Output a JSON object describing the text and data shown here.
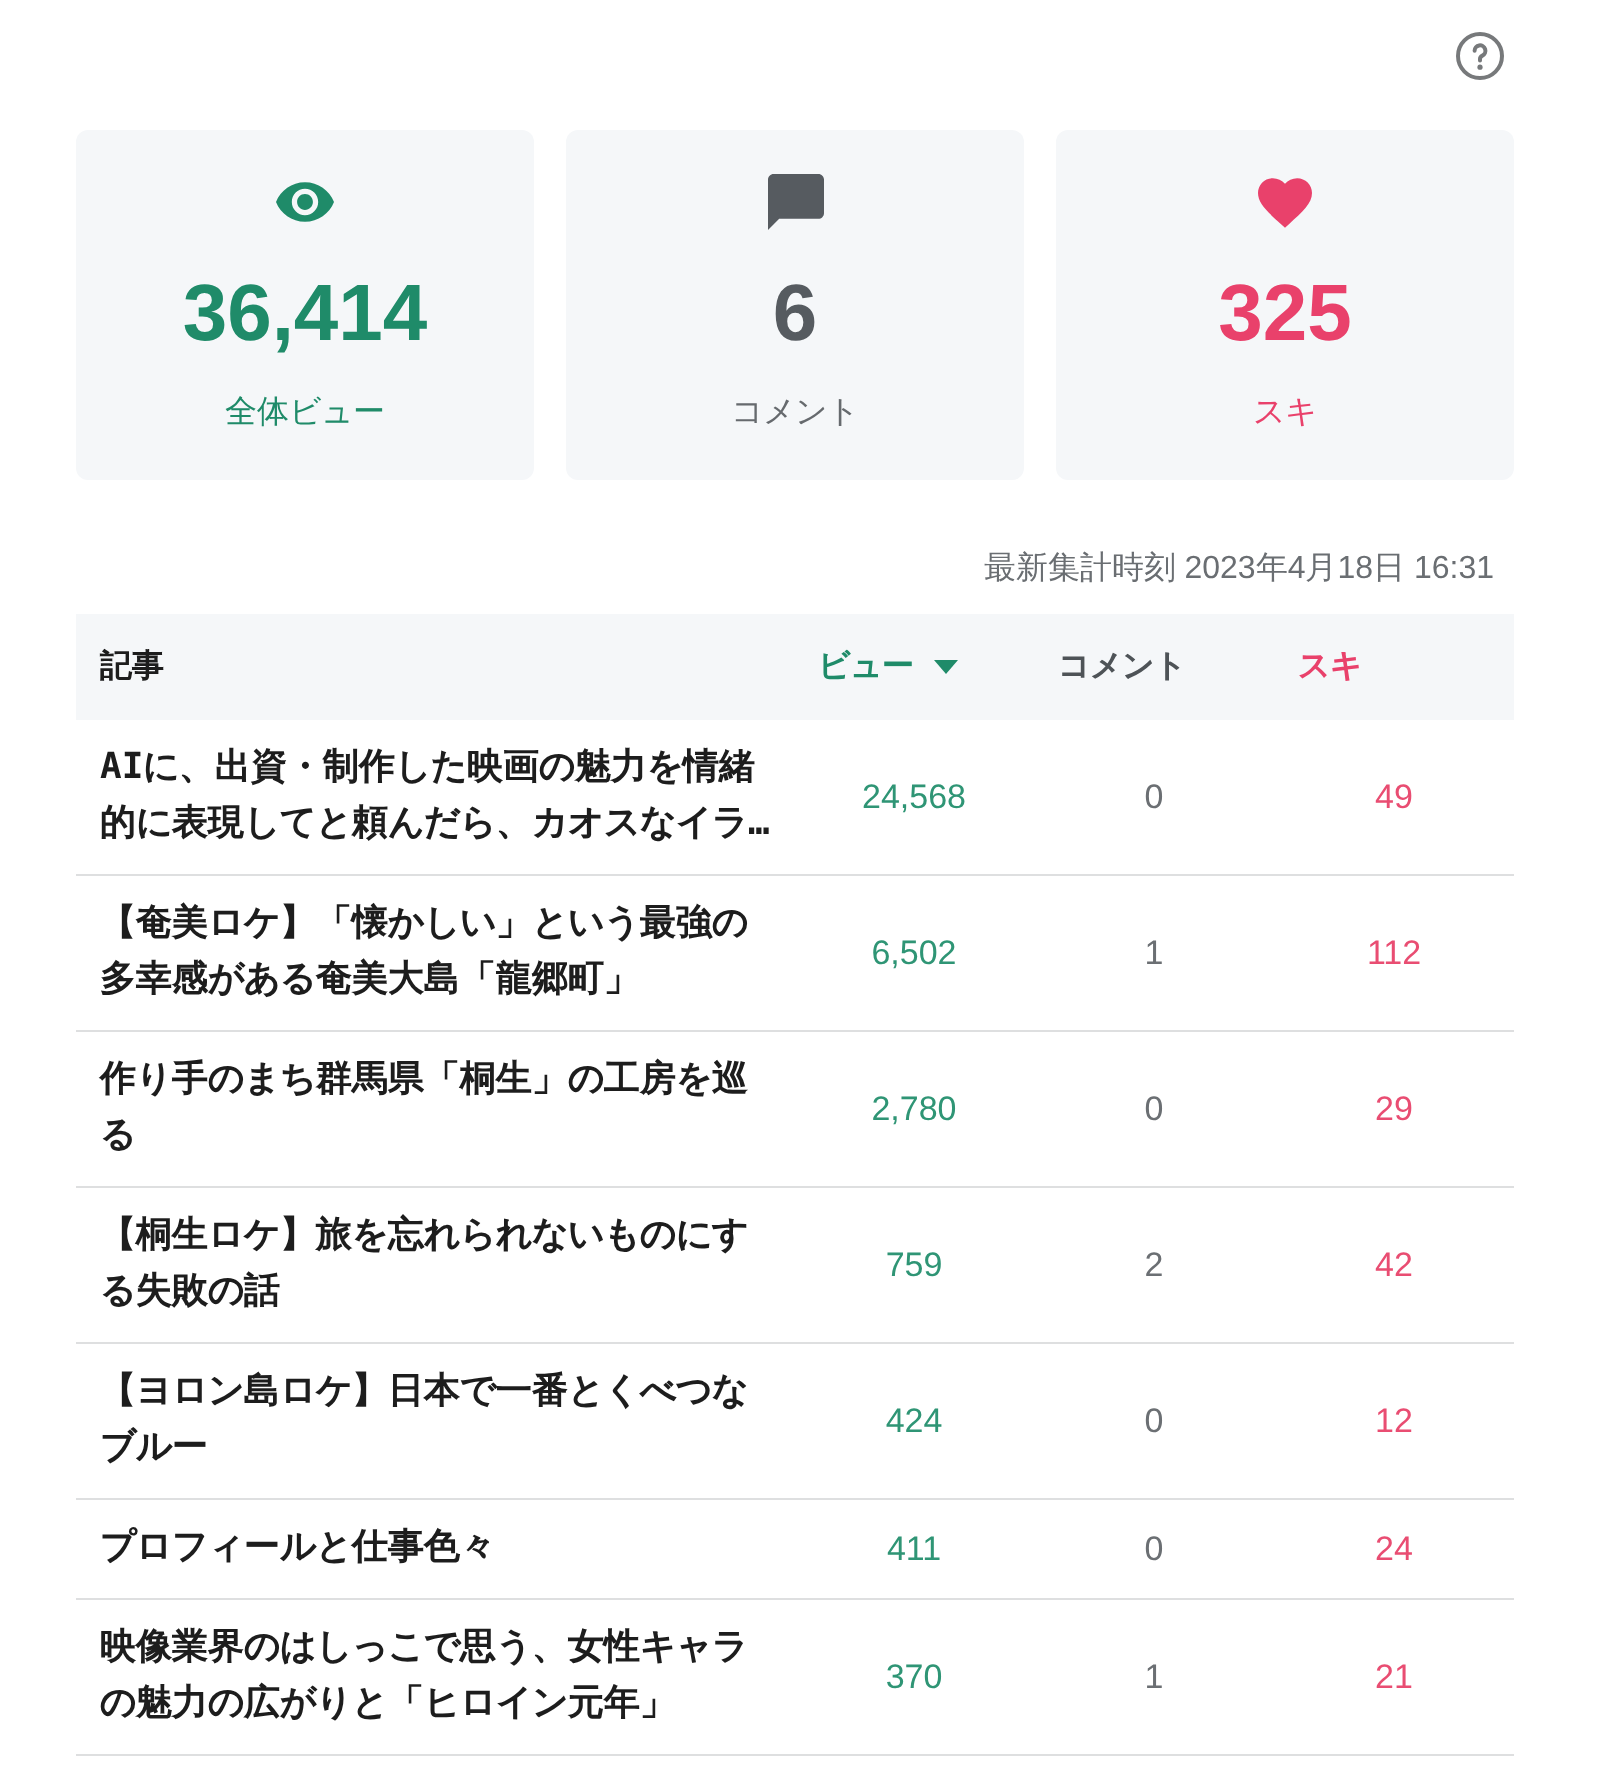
{
  "summary": [
    {
      "kind": "views",
      "value": "36,414",
      "label": "全体ビュー"
    },
    {
      "kind": "comments",
      "value": "6",
      "label": "コメント"
    },
    {
      "kind": "likes",
      "value": "325",
      "label": "スキ"
    }
  ],
  "updated": "最新集計時刻 2023年4月18日 16:31",
  "table": {
    "columns": [
      {
        "kind": "title",
        "label": "記事",
        "sorted": false
      },
      {
        "kind": "views",
        "label": "ビュー",
        "sorted": true
      },
      {
        "kind": "comments",
        "label": "コメント",
        "sorted": false
      },
      {
        "kind": "likes",
        "label": "スキ",
        "sorted": false
      }
    ],
    "rows": [
      {
        "title": "AIに、出資・制作した映画の魅力を情緒的に表現してと頼んだら、カオスなイラ…",
        "views": "24,568",
        "comments": "0",
        "likes": "49"
      },
      {
        "title": "【奄美ロケ】「懐かしい」という最強の多幸感がある奄美大島「龍郷町」",
        "views": "6,502",
        "comments": "1",
        "likes": "112"
      },
      {
        "title": "作り手のまち群馬県「桐生」の工房を巡る",
        "views": "2,780",
        "comments": "0",
        "likes": "29"
      },
      {
        "title": "【桐生ロケ】旅を忘れられないものにする失敗の話",
        "views": "759",
        "comments": "2",
        "likes": "42"
      },
      {
        "title": "【ヨロン島ロケ】日本で一番とくべつなブルー",
        "views": "424",
        "comments": "0",
        "likes": "12"
      },
      {
        "title": "プロフィールと仕事色々",
        "views": "411",
        "comments": "0",
        "likes": "24"
      },
      {
        "title": "映像業界のはしっこで思う、女性キャラの魅力の広がりと「ヒロイン元年」",
        "views": "370",
        "comments": "1",
        "likes": "21"
      }
    ]
  }
}
